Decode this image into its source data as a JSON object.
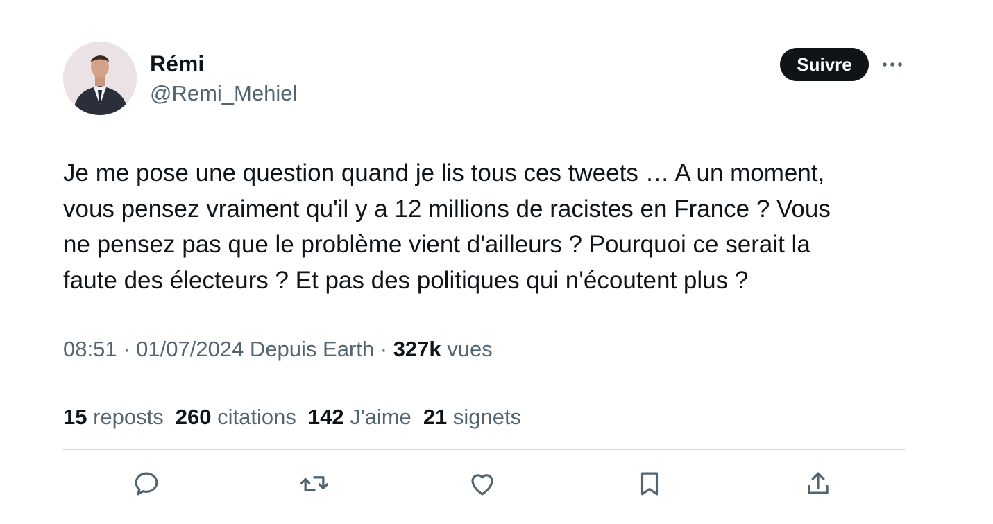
{
  "author": {
    "name": "Rémi",
    "handle": "@Remi_Mehiel"
  },
  "header": {
    "follow_label": "Suivre",
    "more_icon": "more-horizontal-icon"
  },
  "tweet": {
    "text": "Je me pose une question quand je lis tous ces tweets … A un moment,\nvous pensez vraiment qu'il y a 12 millions de racistes en France ? Vous\nne pensez pas que le problème vient d'ailleurs ? Pourquoi ce serait la\nfaute des électeurs ? Et pas des politiques qui n'écoutent plus ?"
  },
  "meta": {
    "time": "08:51",
    "sep1": " · ",
    "date": "01/07/2024",
    "source": " Depuis Earth",
    "sep2": " · ",
    "views_count": "327k",
    "views_label": " vues"
  },
  "stats": [
    {
      "count": "15",
      "label": " reposts"
    },
    {
      "count": "260",
      "label": " citations"
    },
    {
      "count": "142",
      "label": " J'aime"
    },
    {
      "count": "21",
      "label": " signets"
    }
  ],
  "actions": {
    "icons": [
      "reply-icon",
      "retweet-icon",
      "like-icon",
      "bookmark-icon",
      "share-icon"
    ]
  },
  "colors": {
    "text_primary": "#0f1419",
    "text_secondary": "#536471",
    "divider": "#cfd9de",
    "button_bg": "#0f1419"
  }
}
